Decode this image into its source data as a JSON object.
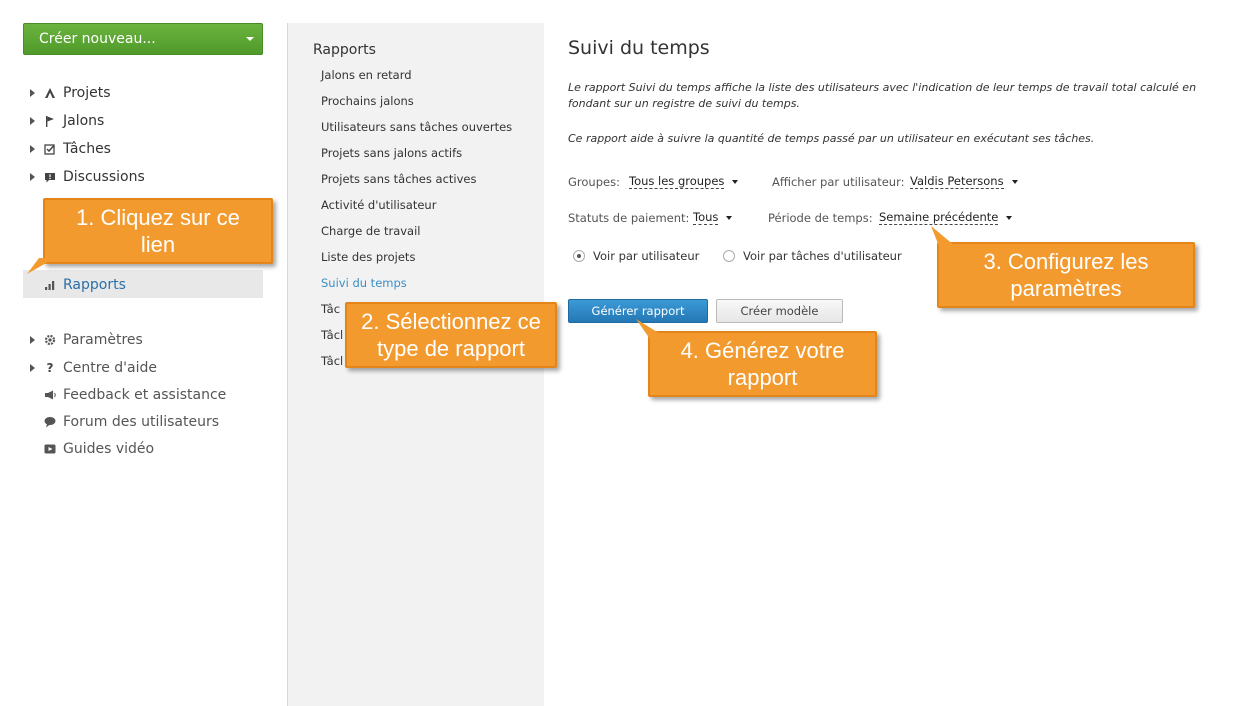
{
  "sidebar": {
    "create_button": "Créer nouveau...",
    "nav_items": [
      {
        "label": "Projets",
        "icon": "projects-icon"
      },
      {
        "label": "Jalons",
        "icon": "flag-icon"
      },
      {
        "label": "Tâches",
        "icon": "checkbox-icon"
      },
      {
        "label": "Discussions",
        "icon": "comment-icon"
      },
      {
        "label": "Rapports",
        "icon": "bar-chart-icon"
      }
    ],
    "footer_items": [
      {
        "label": "Paramètres",
        "icon": "gear-icon"
      },
      {
        "label": "Centre d'aide",
        "icon": "question-icon"
      },
      {
        "label": "Feedback et assistance",
        "icon": "megaphone-icon"
      },
      {
        "label": "Forum des utilisateurs",
        "icon": "speech-bubble-icon"
      },
      {
        "label": "Guides vidéo",
        "icon": "play-icon"
      }
    ]
  },
  "reports": {
    "title": "Rapports",
    "links": [
      "Jalons en retard",
      "Prochains jalons",
      "Utilisateurs sans tâches ouvertes",
      "Projets sans jalons actifs",
      "Projets sans tâches actives",
      "Activité d'utilisateur",
      "Charge de travail",
      "Liste des projets",
      "Suivi du temps",
      "Tâc",
      "Tâcl",
      "Tâcl"
    ],
    "active_link": "Suivi du temps"
  },
  "main": {
    "title": "Suivi du temps",
    "description_1": "Le rapport Suivi du temps affiche la liste des utilisateurs avec l'indication de leur temps de travail total calculé en fondant sur un registre de suivi du temps.",
    "description_2": "Ce rapport aide à suivre la quantité de temps passé par un utilisateur en exécutant ses tâches.",
    "groups_label": "Groupes:",
    "groups_value": "Tous les groupes",
    "user_label": "Afficher par utilisateur:",
    "user_value": "Valdis Petersons",
    "payment_label": "Statuts de paiement:",
    "payment_value": "Tous",
    "period_label": "Période de temps:",
    "period_value": "Semaine précédente",
    "radio_user": "Voir par utilisateur",
    "radio_tasks": "Voir par tâches d'utilisateur",
    "generate_button": "Générer rapport",
    "template_button": "Créer modèle"
  },
  "callouts": {
    "step1": "1. Cliquez sur ce lien",
    "step2": "2. Sélectionnez ce type de rapport",
    "step3": "3. Configurez les paramètres",
    "step4": "4. Générez votre rapport"
  },
  "colors": {
    "accent_green": "#5aa834",
    "accent_blue": "#2a84c3",
    "callout_orange": "#f39a2e",
    "active_link": "#3a8fc7"
  }
}
